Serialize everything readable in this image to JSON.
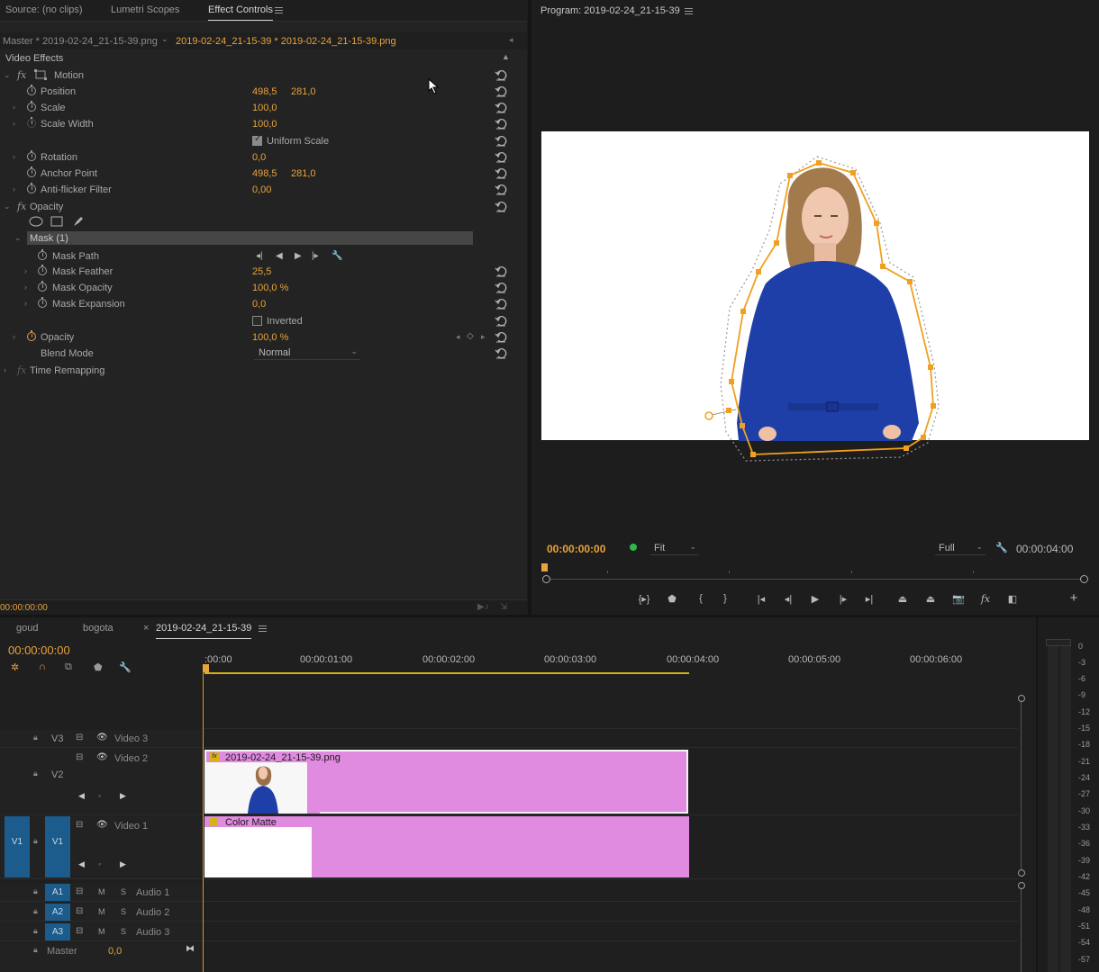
{
  "effect_controls": {
    "tabs": [
      "Source: (no clips)",
      "Lumetri Scopes",
      "Effect Controls"
    ],
    "master_clip": "Master * 2019-02-24_21-15-39.png",
    "sequence_clip": "2019-02-24_21-15-39 * 2019-02-24_21-15-39.png",
    "section_title": "Video Effects",
    "motion": {
      "label": "Motion",
      "position": {
        "label": "Position",
        "x": "498,5",
        "y": "281,0"
      },
      "scale": {
        "label": "Scale",
        "value": "100,0"
      },
      "scale_width": {
        "label": "Scale Width",
        "value": "100,0"
      },
      "uniform_scale": {
        "label": "Uniform Scale",
        "checked": true
      },
      "rotation": {
        "label": "Rotation",
        "value": "0,0"
      },
      "anchor_point": {
        "label": "Anchor Point",
        "x": "498,5",
        "y": "281,0"
      },
      "anti_flicker": {
        "label": "Anti-flicker Filter",
        "value": "0,00"
      }
    },
    "opacity": {
      "label": "Opacity",
      "mask": {
        "label": "Mask (1)",
        "path_label": "Mask Path",
        "feather": {
          "label": "Mask Feather",
          "value": "25,5"
        },
        "opacity": {
          "label": "Mask Opacity",
          "value": "100,0 %"
        },
        "expansion": {
          "label": "Mask Expansion",
          "value": "0,0"
        },
        "inverted": {
          "label": "Inverted",
          "checked": false
        }
      },
      "opacity_value": {
        "label": "Opacity",
        "value": "100,0 %"
      },
      "blend_mode": {
        "label": "Blend Mode",
        "value": "Normal"
      }
    },
    "time_remapping": "Time Remapping",
    "footer_timecode": "00:00:00:00"
  },
  "program": {
    "title": "Program: 2019-02-24_21-15-39",
    "timecode": "00:00:00:00",
    "fit": "Fit",
    "resolution": "Full",
    "duration": "00:00:04:00"
  },
  "timeline": {
    "tabs": [
      "goud",
      "bogota",
      "2019-02-24_21-15-39"
    ],
    "close_glyph": "×",
    "timecode": "00:00:00:00",
    "ruler": [
      ":00:00",
      "00:00:01:00",
      "00:00:02:00",
      "00:00:03:00",
      "00:00:04:00",
      "00:00:05:00",
      "00:00:06:00"
    ],
    "tracks": {
      "v3": {
        "id": "V3",
        "name": "Video 3"
      },
      "v2": {
        "id": "V2",
        "name": "Video 2"
      },
      "v1": {
        "id": "V1",
        "name": "Video 1",
        "source": "V1"
      },
      "a1": {
        "id": "A1",
        "name": "Audio 1"
      },
      "a2": {
        "id": "A2",
        "name": "Audio 2"
      },
      "a3": {
        "id": "A3",
        "name": "Audio 3"
      },
      "master": {
        "name": "Master",
        "value": "0,0"
      }
    },
    "mute_label": "M",
    "solo_label": "S",
    "clips": {
      "v2_clip": "2019-02-24_21-15-39.png",
      "v1_clip": "Color Matte"
    }
  },
  "audio_meter": {
    "labels": [
      "0",
      "-3",
      "-6",
      "-9",
      "-12",
      "-15",
      "-18",
      "-21",
      "-24",
      "-27",
      "-30",
      "-33",
      "-36",
      "-39",
      "-42",
      "-45",
      "-48",
      "-51",
      "-54",
      "-57"
    ]
  },
  "colors": {
    "accent_orange": "#e8a33a",
    "clip_pink": "#e08ae0",
    "track_blue": "#1b5c8c",
    "dress_blue": "#1f3fa8"
  }
}
